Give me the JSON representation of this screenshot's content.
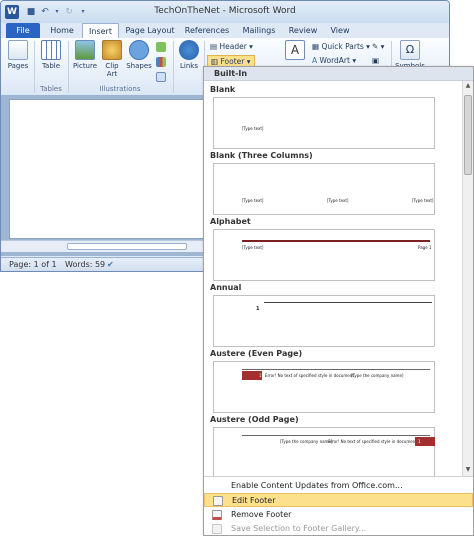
{
  "window": {
    "title": "TechOnTheNet - Microsoft Word",
    "app_icon_letter": "W"
  },
  "tabs": [
    "File",
    "Home",
    "Insert",
    "Page Layout",
    "References",
    "Mailings",
    "Review",
    "View"
  ],
  "ribbon": {
    "pages": "Pages",
    "table": "Table",
    "picture": "Picture",
    "clip_art": "Clip Art",
    "shapes": "Shapes",
    "links": "Links",
    "header": "Header",
    "footer": "Footer",
    "quick_parts": "Quick Parts",
    "wordart": "WordArt",
    "symbols": "Symbols",
    "groups": {
      "tables": "Tables",
      "illustrations": "Illustrations"
    }
  },
  "status": {
    "page": "Page: 1 of 1",
    "words": "Words: 59"
  },
  "footer_pane": {
    "section": "Built-In",
    "items": [
      {
        "title": "Blank",
        "texts": [
          "[Type text]"
        ]
      },
      {
        "title": "Blank (Three Columns)",
        "texts": [
          "[Type text]",
          "[Type text]",
          "[Type text]"
        ]
      },
      {
        "title": "Alphabet",
        "texts": [
          "[Type text]",
          "Page 1"
        ]
      },
      {
        "title": "Annual",
        "texts": [
          "1"
        ]
      },
      {
        "title": "Austere (Even Page)",
        "texts": [
          "1",
          "Error! No text of specified style in document.",
          "[Type the company name]"
        ]
      },
      {
        "title": "Austere (Odd Page)",
        "texts": [
          "[Type the company name]",
          "Error! No text of specified style in document.",
          "1"
        ]
      }
    ],
    "menu": {
      "enable_updates": "Enable Content Updates from Office.com...",
      "edit_footer": "Edit Footer",
      "remove_footer": "Remove Footer",
      "save_selection": "Save Selection to Footer Gallery..."
    }
  },
  "colors": {
    "accent_blue": "#2b579a",
    "file_tab": "#2b65c4",
    "highlight": "#fde08c",
    "alphabet_rule": "#7a2222",
    "austere_block": "#a3302f"
  }
}
